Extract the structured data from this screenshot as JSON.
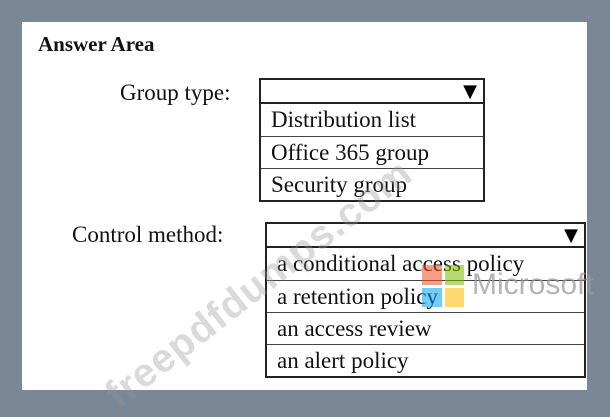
{
  "answer_area": {
    "title": "Answer Area"
  },
  "group_type": {
    "label": "Group type:",
    "selected": "",
    "options": [
      "Distribution list",
      "Office 365 group",
      "Security group"
    ]
  },
  "control_method": {
    "label": "Control method:",
    "selected": "",
    "options": [
      "a conditional access policy",
      "a retention policy",
      "an access review",
      "an alert policy"
    ]
  },
  "icons": {
    "dropdown_arrow": "▼"
  },
  "overlay": {
    "watermark": "freepdfdumps.com",
    "brand_text": "Microsoft",
    "brand_colors": [
      "#f25022",
      "#7fba00",
      "#00a4ef",
      "#ffb900"
    ]
  },
  "colors": {
    "frame": "#7a8797",
    "panel": "#ffffff"
  }
}
